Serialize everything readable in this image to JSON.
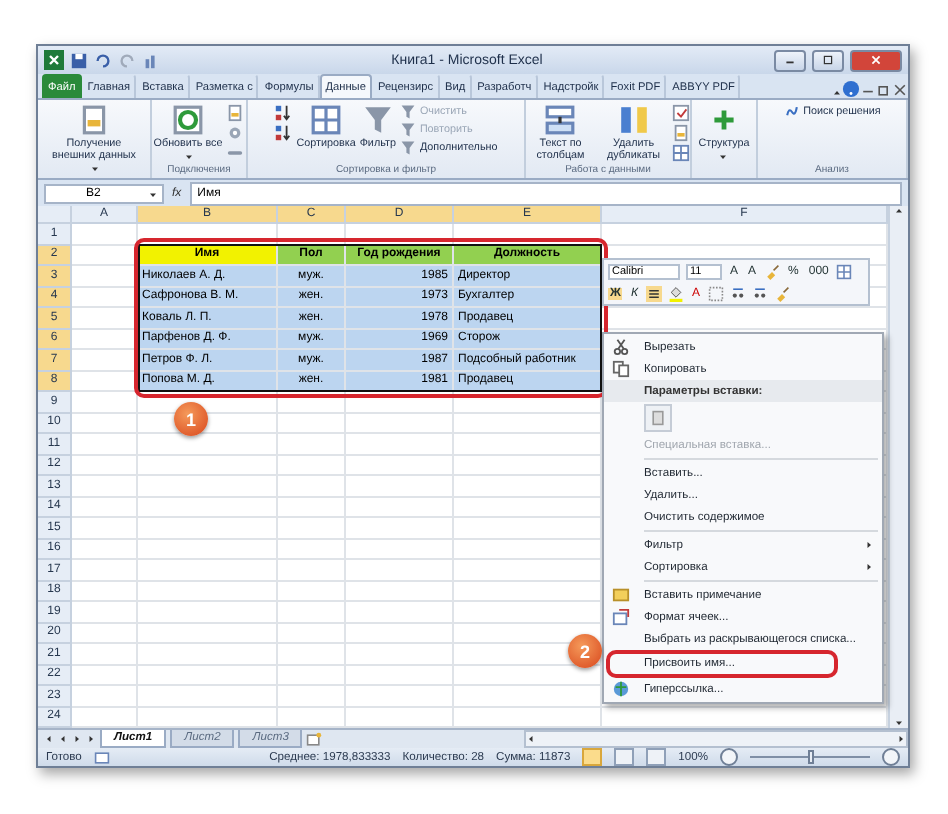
{
  "window": {
    "title": "Книга1 - Microsoft Excel"
  },
  "tabs": [
    {
      "label": "Файл",
      "kind": "file",
      "selected": false
    },
    {
      "label": "Главная",
      "kind": "tab",
      "selected": false
    },
    {
      "label": "Вставка",
      "kind": "tab",
      "selected": false
    },
    {
      "label": "Разметка с",
      "kind": "tab",
      "selected": false
    },
    {
      "label": "Формулы",
      "kind": "tab",
      "selected": false
    },
    {
      "label": "Данные",
      "kind": "tab",
      "selected": true
    },
    {
      "label": "Рецензирс",
      "kind": "tab",
      "selected": false
    },
    {
      "label": "Вид",
      "kind": "tab",
      "selected": false
    },
    {
      "label": "Разработч",
      "kind": "tab",
      "selected": false
    },
    {
      "label": "Надстройк",
      "kind": "tab",
      "selected": false
    },
    {
      "label": "Foxit PDF",
      "kind": "tab",
      "selected": false
    },
    {
      "label": "ABBYY PDF",
      "kind": "tab",
      "selected": false
    }
  ],
  "ribbon": [
    {
      "items": [
        {
          "kind": "big",
          "label": "Получение внешних данных",
          "dropdown": true
        }
      ]
    },
    {
      "label": "Подключения",
      "items": [
        {
          "kind": "big",
          "label": "Обновить все",
          "dropdown": true
        }
      ]
    },
    {
      "label": "Сортировка и фильтр",
      "items": [
        {
          "kind": "big",
          "label": "Сортировка",
          "dropdown": false
        },
        {
          "kind": "big",
          "label": "Фильтр",
          "dropdown": false
        },
        {
          "kind": "smalls",
          "items": [
            {
              "label": "Очистить",
              "disabled": true
            },
            {
              "label": "Повторить",
              "disabled": true
            },
            {
              "label": "Дополнительно",
              "disabled": false
            }
          ]
        }
      ]
    },
    {
      "label": "Работа с данными",
      "items": [
        {
          "kind": "big",
          "label": "Текст по столбцам",
          "dropdown": false
        },
        {
          "kind": "big",
          "label": "Удалить дубликаты",
          "dropdown": false
        }
      ]
    },
    {
      "items": [
        {
          "kind": "big",
          "label": "Структура",
          "dropdown": true
        }
      ]
    },
    {
      "label": "Анализ",
      "items": [
        {
          "kind": "smalls",
          "items": [
            {
              "label": "Поиск решения",
              "disabled": false
            }
          ]
        }
      ]
    }
  ],
  "formula_bar": {
    "name_box": "B2",
    "fx": "fx",
    "formula": "Имя"
  },
  "columns": [
    {
      "label": "A",
      "selected": false
    },
    {
      "label": "B",
      "selected": true
    },
    {
      "label": "C",
      "selected": true
    },
    {
      "label": "D",
      "selected": true
    },
    {
      "label": "E",
      "selected": true
    },
    {
      "label": "F",
      "selected": false
    }
  ],
  "rows": [
    {
      "number": "1",
      "selected": false
    },
    {
      "number": "2",
      "selected": true,
      "cells": [
        {
          "text": "Имя",
          "kind": "header",
          "color": "#f2f200"
        },
        {
          "text": "Пол",
          "kind": "header",
          "color": "#92d050"
        },
        {
          "text": "Год рождения",
          "kind": "header",
          "color": "#92d050"
        },
        {
          "text": "Должность",
          "kind": "header",
          "color": "#92d050"
        }
      ]
    },
    {
      "number": "3",
      "selected": true,
      "cells": [
        {
          "text": "Николаев А. Д.",
          "kind": "data"
        },
        {
          "text": "муж.",
          "kind": "data"
        },
        {
          "text": "1985",
          "kind": "data"
        },
        {
          "text": "Директор",
          "kind": "data"
        }
      ]
    },
    {
      "number": "4",
      "selected": true,
      "cells": [
        {
          "text": "Сафронова В. М.",
          "kind": "data"
        },
        {
          "text": "жен.",
          "kind": "data"
        },
        {
          "text": "1973",
          "kind": "data"
        },
        {
          "text": "Бухгалтер",
          "kind": "data"
        }
      ]
    },
    {
      "number": "5",
      "selected": true,
      "cells": [
        {
          "text": "Коваль Л. П.",
          "kind": "data"
        },
        {
          "text": "жен.",
          "kind": "data"
        },
        {
          "text": "1978",
          "kind": "data"
        },
        {
          "text": "Продавец",
          "kind": "data"
        }
      ]
    },
    {
      "number": "6",
      "selected": true,
      "cells": [
        {
          "text": "Парфенов Д. Ф.",
          "kind": "data"
        },
        {
          "text": "муж.",
          "kind": "data"
        },
        {
          "text": "1969",
          "kind": "data"
        },
        {
          "text": "Сторож",
          "kind": "data"
        }
      ]
    },
    {
      "number": "7",
      "selected": true,
      "cells": [
        {
          "text": "Петров Ф. Л.",
          "kind": "data"
        },
        {
          "text": "муж.",
          "kind": "data"
        },
        {
          "text": "1987",
          "kind": "data"
        },
        {
          "text": "Подсобный работник",
          "kind": "data"
        }
      ]
    },
    {
      "number": "8",
      "selected": true,
      "cells": [
        {
          "text": "Попова М. Д.",
          "kind": "data"
        },
        {
          "text": "жен.",
          "kind": "data"
        },
        {
          "text": "1981",
          "kind": "data"
        },
        {
          "text": "Продавец",
          "kind": "data"
        }
      ]
    },
    {
      "number": "9",
      "selected": false
    },
    {
      "number": "10",
      "selected": false
    },
    {
      "number": "11",
      "selected": false
    },
    {
      "number": "12",
      "selected": false
    },
    {
      "number": "13",
      "selected": false
    },
    {
      "number": "14",
      "selected": false
    },
    {
      "number": "15",
      "selected": false
    },
    {
      "number": "16",
      "selected": false
    },
    {
      "number": "17",
      "selected": false
    },
    {
      "number": "18",
      "selected": false
    },
    {
      "number": "19",
      "selected": false
    },
    {
      "number": "20",
      "selected": false
    },
    {
      "number": "21",
      "selected": false
    },
    {
      "number": "22",
      "selected": false
    },
    {
      "number": "23",
      "selected": false
    },
    {
      "number": "24",
      "selected": false
    }
  ],
  "mini_toolbar": {
    "font": "Calibri",
    "size": "11",
    "row1": [
      {
        "kind": "plain",
        "label": "A"
      },
      {
        "kind": "plain",
        "label": "A"
      },
      {
        "kind": "plain",
        "label": "%"
      },
      {
        "kind": "plain",
        "label": "000"
      }
    ],
    "row2": [
      {
        "kind": "bold",
        "label": "Ж"
      },
      {
        "kind": "italic",
        "label": "К"
      },
      {
        "kind": "font_color",
        "label": "A"
      }
    ]
  },
  "context_menu": [
    {
      "kind": "item",
      "label": "Вырезать",
      "disabled": false,
      "submenu": false,
      "circled": false
    },
    {
      "kind": "item",
      "label": "Копировать",
      "disabled": false,
      "submenu": false,
      "circled": false
    },
    {
      "kind": "header",
      "label": "Параметры вставки:"
    },
    {
      "kind": "paste_options"
    },
    {
      "kind": "item",
      "label": "Специальная вставка...",
      "disabled": true,
      "submenu": false,
      "circled": false
    },
    {
      "kind": "separator"
    },
    {
      "kind": "item",
      "label": "Вставить...",
      "disabled": false,
      "submenu": false,
      "circled": false
    },
    {
      "kind": "item",
      "label": "Удалить...",
      "disabled": false,
      "submenu": false,
      "circled": false
    },
    {
      "kind": "item",
      "label": "Очистить содержимое",
      "disabled": false,
      "submenu": false,
      "circled": false
    },
    {
      "kind": "separator"
    },
    {
      "kind": "item",
      "label": "Фильтр",
      "disabled": false,
      "submenu": true,
      "circled": false
    },
    {
      "kind": "item",
      "label": "Сортировка",
      "disabled": false,
      "submenu": true,
      "circled": false
    },
    {
      "kind": "separator"
    },
    {
      "kind": "item",
      "label": "Вставить примечание",
      "disabled": false,
      "submenu": false,
      "circled": false
    },
    {
      "kind": "item",
      "label": "Формат ячеек...",
      "disabled": false,
      "submenu": false,
      "circled": false
    },
    {
      "kind": "item",
      "label": "Выбрать из раскрывающегося списка...",
      "disabled": false,
      "submenu": false,
      "circled": false
    },
    {
      "kind": "item",
      "label": "Присвоить имя...",
      "disabled": false,
      "submenu": false,
      "circled": true
    },
    {
      "kind": "item",
      "label": "Гиперссылка...",
      "disabled": false,
      "submenu": false,
      "circled": false
    }
  ],
  "callouts": [
    {
      "label": "1"
    },
    {
      "label": "2"
    }
  ],
  "sheet_tabs": [
    {
      "label": "Лист1",
      "selected": true
    },
    {
      "label": "Лист2",
      "selected": false
    },
    {
      "label": "Лист3",
      "selected": false
    }
  ],
  "status_bar": {
    "ready": "Готово",
    "average": "Среднее: 1978,833333",
    "count": "Количество: 28",
    "sum": "Сумма: 11873",
    "views": [
      {
        "selected": true
      },
      {
        "selected": false
      },
      {
        "selected": false
      }
    ],
    "zoom": "100%",
    "zoom_slider": {
      "level": 0.5
    }
  }
}
